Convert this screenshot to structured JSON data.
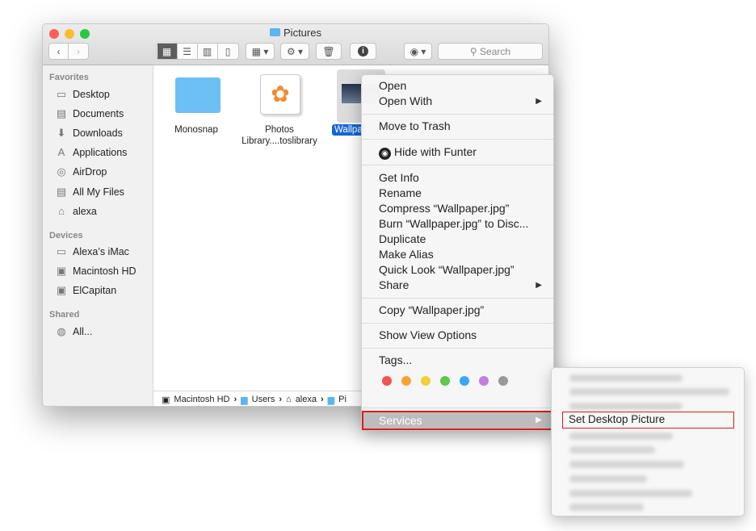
{
  "window": {
    "title": "Pictures",
    "toolbar": {
      "search_placeholder": "Search",
      "icons": [
        "back-icon",
        "forward-icon",
        "icon-view-icon",
        "list-view-icon",
        "column-view-icon",
        "coverflow-view-icon",
        "arrange-icon",
        "gear-icon",
        "trash-icon",
        "info-icon",
        "funter-eye-icon",
        "search-icon"
      ]
    },
    "sidebar": {
      "sections": [
        {
          "label": "Favorites",
          "items": [
            {
              "label": "Desktop",
              "icon": "desktop-icon"
            },
            {
              "label": "Documents",
              "icon": "documents-icon"
            },
            {
              "label": "Downloads",
              "icon": "downloads-icon"
            },
            {
              "label": "Applications",
              "icon": "applications-icon"
            },
            {
              "label": "AirDrop",
              "icon": "airdrop-icon"
            },
            {
              "label": "All My Files",
              "icon": "all-files-icon"
            },
            {
              "label": "alexa",
              "icon": "home-icon"
            }
          ]
        },
        {
          "label": "Devices",
          "items": [
            {
              "label": "Alexa’s iMac",
              "icon": "imac-icon"
            },
            {
              "label": "Macintosh HD",
              "icon": "disk-icon"
            },
            {
              "label": "ElCapitan",
              "icon": "disk-icon"
            }
          ]
        },
        {
          "label": "Shared",
          "items": [
            {
              "label": "All...",
              "icon": "network-icon"
            }
          ]
        }
      ]
    },
    "files": [
      {
        "name": "Monosnap",
        "icon": "folder-icon"
      },
      {
        "name": "Photos Library....toslibrary",
        "icon": "photos-icon"
      },
      {
        "name": "Wallpaper.jpg",
        "label_visible": "Wallpa",
        "selected": true
      }
    ],
    "pathbar": [
      {
        "label": "Macintosh HD"
      },
      {
        "label": "Users"
      },
      {
        "label": "alexa"
      },
      {
        "label": "Pi"
      }
    ]
  },
  "context_menu": {
    "items": [
      "Open",
      "Open With",
      "Move to Trash",
      "Hide with Funter",
      "Get Info",
      "Rename",
      "Compress “Wallpaper.jpg”",
      "Burn “Wallpaper.jpg” to Disc...",
      "Duplicate",
      "Make Alias",
      "Quick Look “Wallpaper.jpg”",
      "Share",
      "Copy “Wallpaper.jpg”",
      "Show View Options",
      "Tags...",
      "Services"
    ],
    "tag_colors": [
      "#f5514f",
      "#f7a238",
      "#f5cd3a",
      "#5dc84f",
      "#39a7f5",
      "#c77de0",
      "#9a9a9a"
    ],
    "highlight_color": "#e01b1b"
  },
  "services_submenu": {
    "highlighted": "Set Desktop Picture"
  }
}
